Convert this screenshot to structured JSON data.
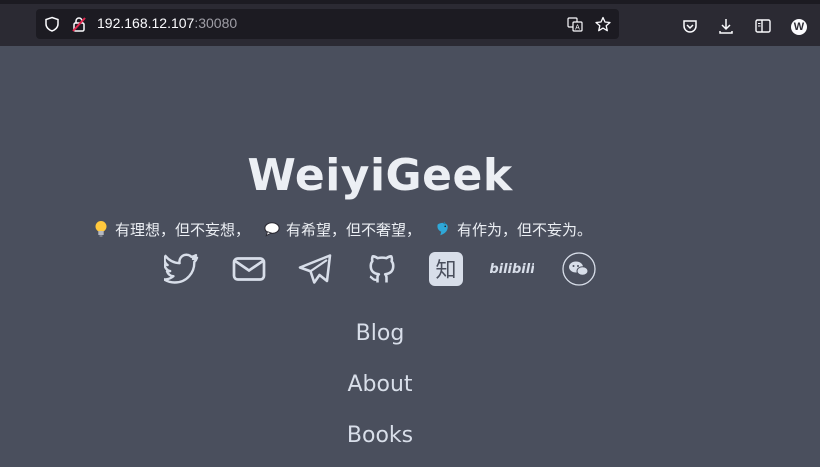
{
  "browser": {
    "url_host": "192.168.12.107",
    "url_port": ":30080",
    "profile_initial": "W"
  },
  "site": {
    "title": "WeiyiGeek",
    "motto": {
      "part1": "有理想，但不妄想，",
      "part2": "有希望，但不奢望，",
      "part3": "有作为，但不妄为。"
    }
  },
  "social_icons": [
    "twitter-icon",
    "mail-icon",
    "telegram-icon",
    "github-icon",
    "zhihu-icon",
    "bilibili-icon",
    "wechat-icon"
  ],
  "social": {
    "zhihu_glyph": "知",
    "bilibili_text": "bilibili"
  },
  "nav": {
    "items": [
      "Blog",
      "About",
      "Books"
    ]
  },
  "colors": {
    "page_bg": "#4a4f5d",
    "text": "#eceff4",
    "icon": "#d8dee9",
    "chrome_bg": "#2b2a33",
    "urlbar_bg": "#1c1b22"
  }
}
